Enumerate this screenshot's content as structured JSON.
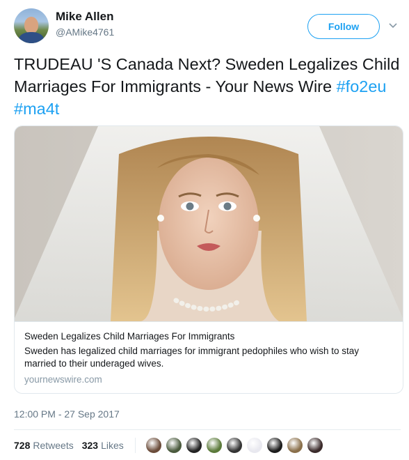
{
  "user": {
    "name": "Mike Allen",
    "handle": "@AMike4761",
    "follow_label": "Follow"
  },
  "tweet": {
    "text": "TRUDEAU 'S Canada Next? Sweden Legalizes Child Marriages For Immigrants - Your News Wire",
    "hashtags": [
      "#fo2eu",
      "#ma4t"
    ]
  },
  "card": {
    "title": "Sweden Legalizes Child Marriages For Immigrants",
    "description": "Sweden has legalized child marriages for immigrant pedophiles who wish to stay married to their underaged wives.",
    "domain": "yournewswire.com"
  },
  "meta": {
    "timestamp": "12:00 PM - 27 Sep 2017"
  },
  "stats": {
    "retweets_count": "728",
    "retweets_label": "Retweets",
    "likes_count": "323",
    "likes_label": "Likes"
  },
  "colors": {
    "accent": "#1da1f2",
    "secondary_text": "#657786",
    "border": "#e1e8ed"
  },
  "icons": {
    "menu": "chevron-down-icon"
  },
  "likers": [
    {
      "name": "liker-avatar-1",
      "color": "#6b4c3a"
    },
    {
      "name": "liker-avatar-2",
      "color": "#4a5a3d"
    },
    {
      "name": "liker-avatar-3",
      "color": "#222222"
    },
    {
      "name": "liker-avatar-4",
      "color": "#5b7a3a"
    },
    {
      "name": "liker-avatar-5",
      "color": "#333333"
    },
    {
      "name": "liker-avatar-6",
      "color": "#e8e8ef"
    },
    {
      "name": "liker-avatar-7",
      "color": "#1b1b1b"
    },
    {
      "name": "liker-avatar-8",
      "color": "#8a6f4a"
    },
    {
      "name": "liker-avatar-9",
      "color": "#3a2a2a"
    }
  ]
}
